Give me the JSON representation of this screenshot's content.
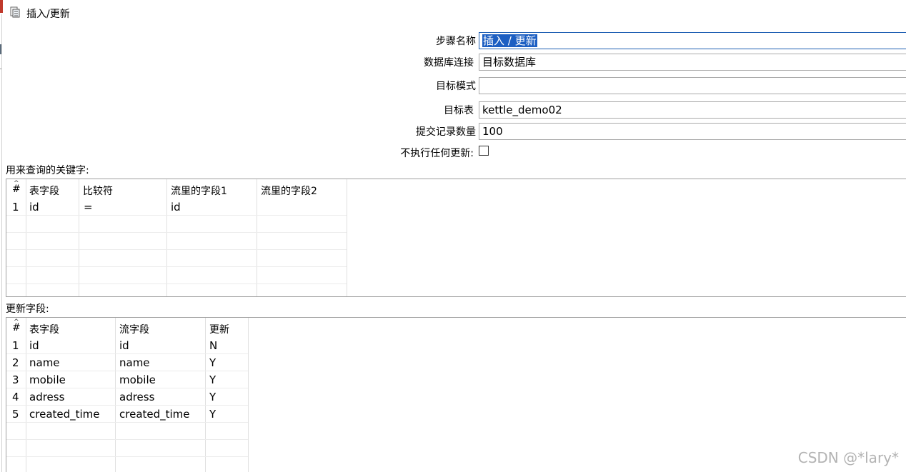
{
  "window": {
    "title": "插入/更新",
    "title_icon": "document-table-icon"
  },
  "form": {
    "step_name_label": "步骤名称",
    "step_name_value": "插入 / 更新",
    "connection_label": "数据库连接",
    "connection_value": "目标数据库",
    "schema_label": "目标模式",
    "schema_value": "",
    "table_label": "目标表",
    "table_value": "kettle_demo02",
    "commit_label": "提交记录数量",
    "commit_value": "100",
    "no_update_label": "不执行任何更新:",
    "no_update_checked": false
  },
  "keys": {
    "section_label": "用来查询的关键字:",
    "headers": [
      "#",
      "表字段",
      "比较符",
      "流里的字段1",
      "流里的字段2"
    ],
    "rows": [
      [
        "1",
        "id",
        "=",
        "id",
        ""
      ]
    ]
  },
  "updates": {
    "section_label": "更新字段:",
    "headers": [
      "#",
      "表字段",
      "流字段",
      "更新"
    ],
    "rows": [
      [
        "1",
        "id",
        "id",
        "N"
      ],
      [
        "2",
        "name",
        "name",
        "Y"
      ],
      [
        "3",
        "mobile",
        "mobile",
        "Y"
      ],
      [
        "4",
        "adress",
        "adress",
        "Y"
      ],
      [
        "5",
        "created_time",
        "created_time",
        "Y"
      ]
    ]
  },
  "watermark": "CSDN @*lary*",
  "colors": {
    "selection": "#1d5fc2",
    "focus_border": "#1e5fb3",
    "grid_line": "#e0e0e0"
  }
}
